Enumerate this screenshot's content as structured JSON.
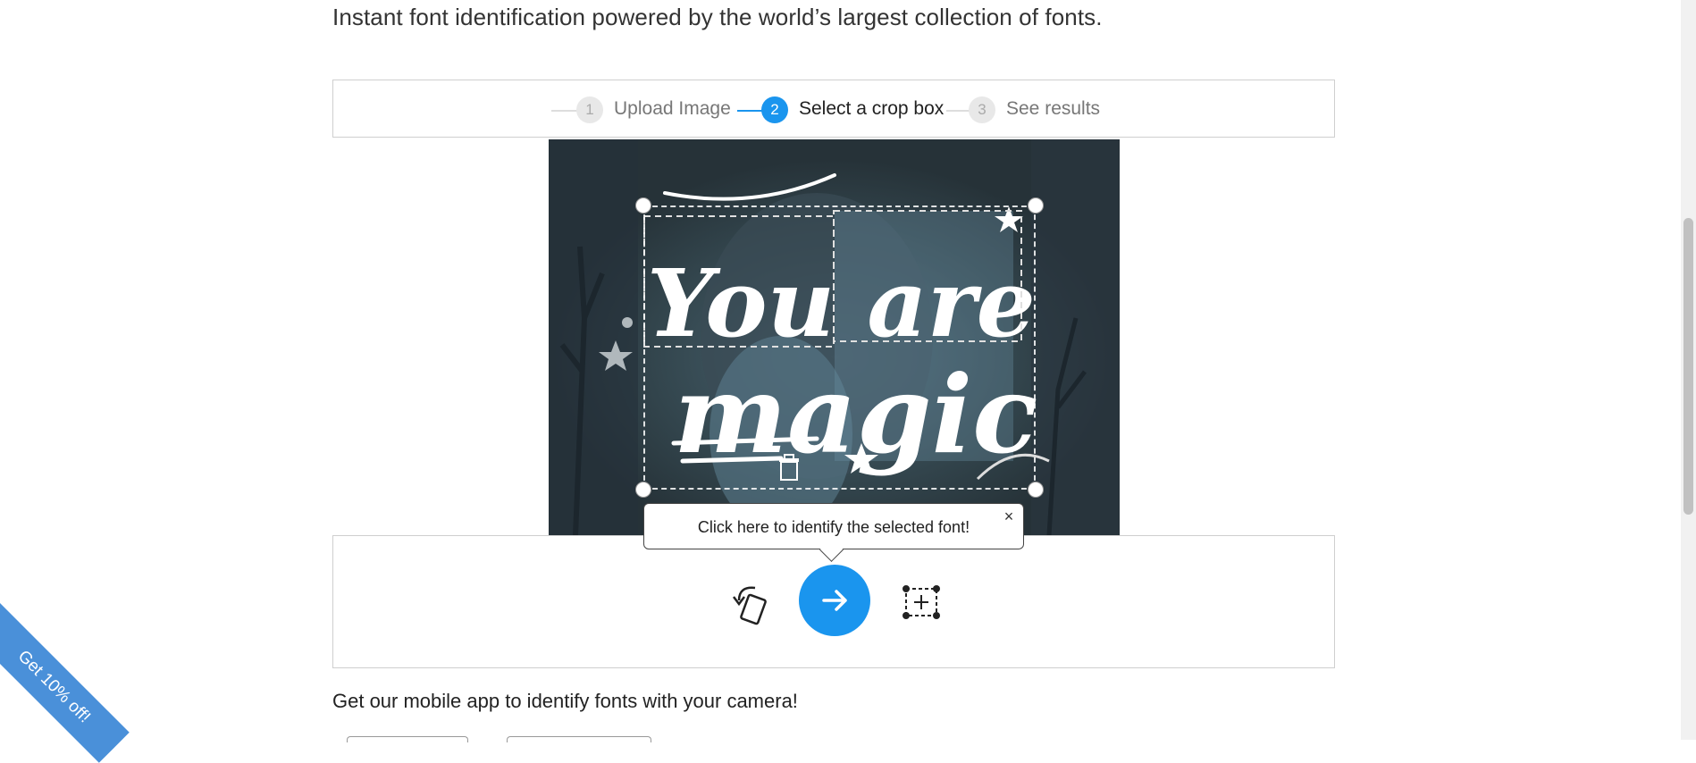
{
  "header": {
    "tagline": "Instant font identification powered by the world’s largest collection of fonts."
  },
  "steps": [
    {
      "number": "1",
      "label": "Upload Image",
      "state": "done"
    },
    {
      "number": "2",
      "label": "Select a crop box",
      "state": "active"
    },
    {
      "number": "3",
      "label": "See results",
      "state": "pending"
    }
  ],
  "image": {
    "text_line1": "You are",
    "text_line2": "magic"
  },
  "tooltip": {
    "text": "Click here to identify the selected font!",
    "close_glyph": "×"
  },
  "controls": {
    "rotate_icon": "rotate-icon",
    "go_icon": "arrow-right-icon",
    "add_crop_icon": "add-crop-box-icon"
  },
  "footer": {
    "app_text": "Get our mobile app to identify fonts with your camera!"
  },
  "promo": {
    "text": "Get 10% off!",
    "caret": "▲"
  },
  "colors": {
    "accent": "#1a95ee",
    "promo": "#4a90d9"
  }
}
